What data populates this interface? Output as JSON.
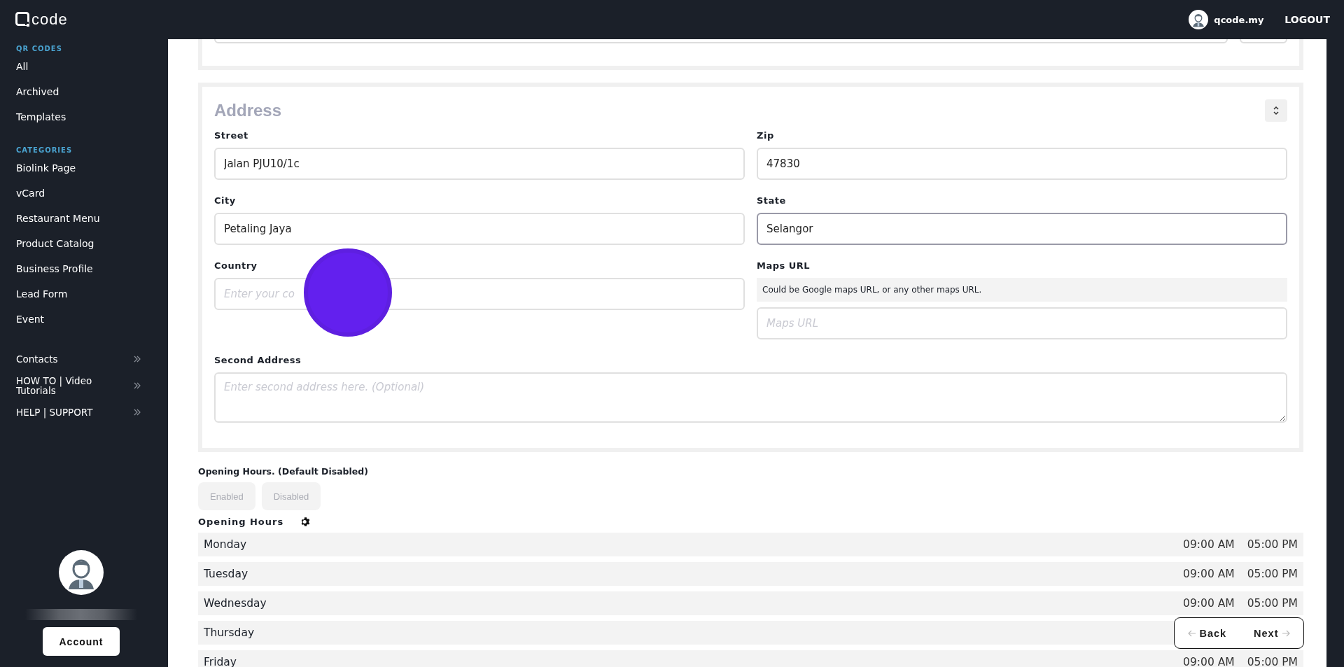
{
  "header": {
    "logo": "code",
    "user": "qcode.my",
    "logout": "LOGOUT"
  },
  "sidebar": {
    "sections": [
      {
        "heading": "QR CODES",
        "items": [
          "All",
          "Archived",
          "Templates"
        ]
      },
      {
        "heading": "CATEGORIES",
        "items": [
          "Biolink Page",
          "vCard",
          "Restaurant Menu",
          "Product Catalog",
          "Business Profile",
          "Lead Form",
          "Event"
        ]
      }
    ],
    "expandable": [
      "Contacts",
      "HOW TO | Video Tutorials",
      "HELP | SUPPORT"
    ],
    "account_button": "Account"
  },
  "address": {
    "title": "Address",
    "fields": [
      {
        "kind": "input",
        "label": "Street",
        "value": "Jalan PJU10/1c",
        "focused": false
      },
      {
        "kind": "input",
        "label": "Zip",
        "value": "47830",
        "focused": false
      },
      {
        "kind": "input",
        "label": "City",
        "value": "Petaling Jaya",
        "focused": false
      },
      {
        "kind": "input",
        "label": "State",
        "value": "Selangor",
        "focused": true
      },
      {
        "kind": "input",
        "label": "Country",
        "placeholder": "Enter your co",
        "focused": false,
        "click_marker": true
      },
      {
        "kind": "input",
        "label": "Maps URL",
        "hint": "Could be Google maps URL, or any other maps URL.",
        "placeholder": "Maps URL",
        "focused": false
      },
      {
        "kind": "textarea",
        "label": "Second Address",
        "placeholder": "Enter second address here. (Optional)",
        "focused": false
      }
    ]
  },
  "opening_hours": {
    "toggle_label": "Opening Hours. (Default Disabled)",
    "toggle": [
      {
        "label": "Enabled",
        "selected": false
      },
      {
        "label": "Disabled",
        "selected": false
      }
    ],
    "title": "Opening Hours",
    "days": [
      {
        "day": "Monday",
        "open": "09:00 AM",
        "close": "05:00 PM"
      },
      {
        "day": "Tuesday",
        "open": "09:00 AM",
        "close": "05:00 PM"
      },
      {
        "day": "Wednesday",
        "open": "09:00 AM",
        "close": "05:00 PM"
      },
      {
        "day": "Thursday"
      },
      {
        "day": "Friday",
        "open": "09:00 AM",
        "close": "05:00 PM"
      }
    ]
  },
  "nav": {
    "back": "Back",
    "next": "Next"
  }
}
